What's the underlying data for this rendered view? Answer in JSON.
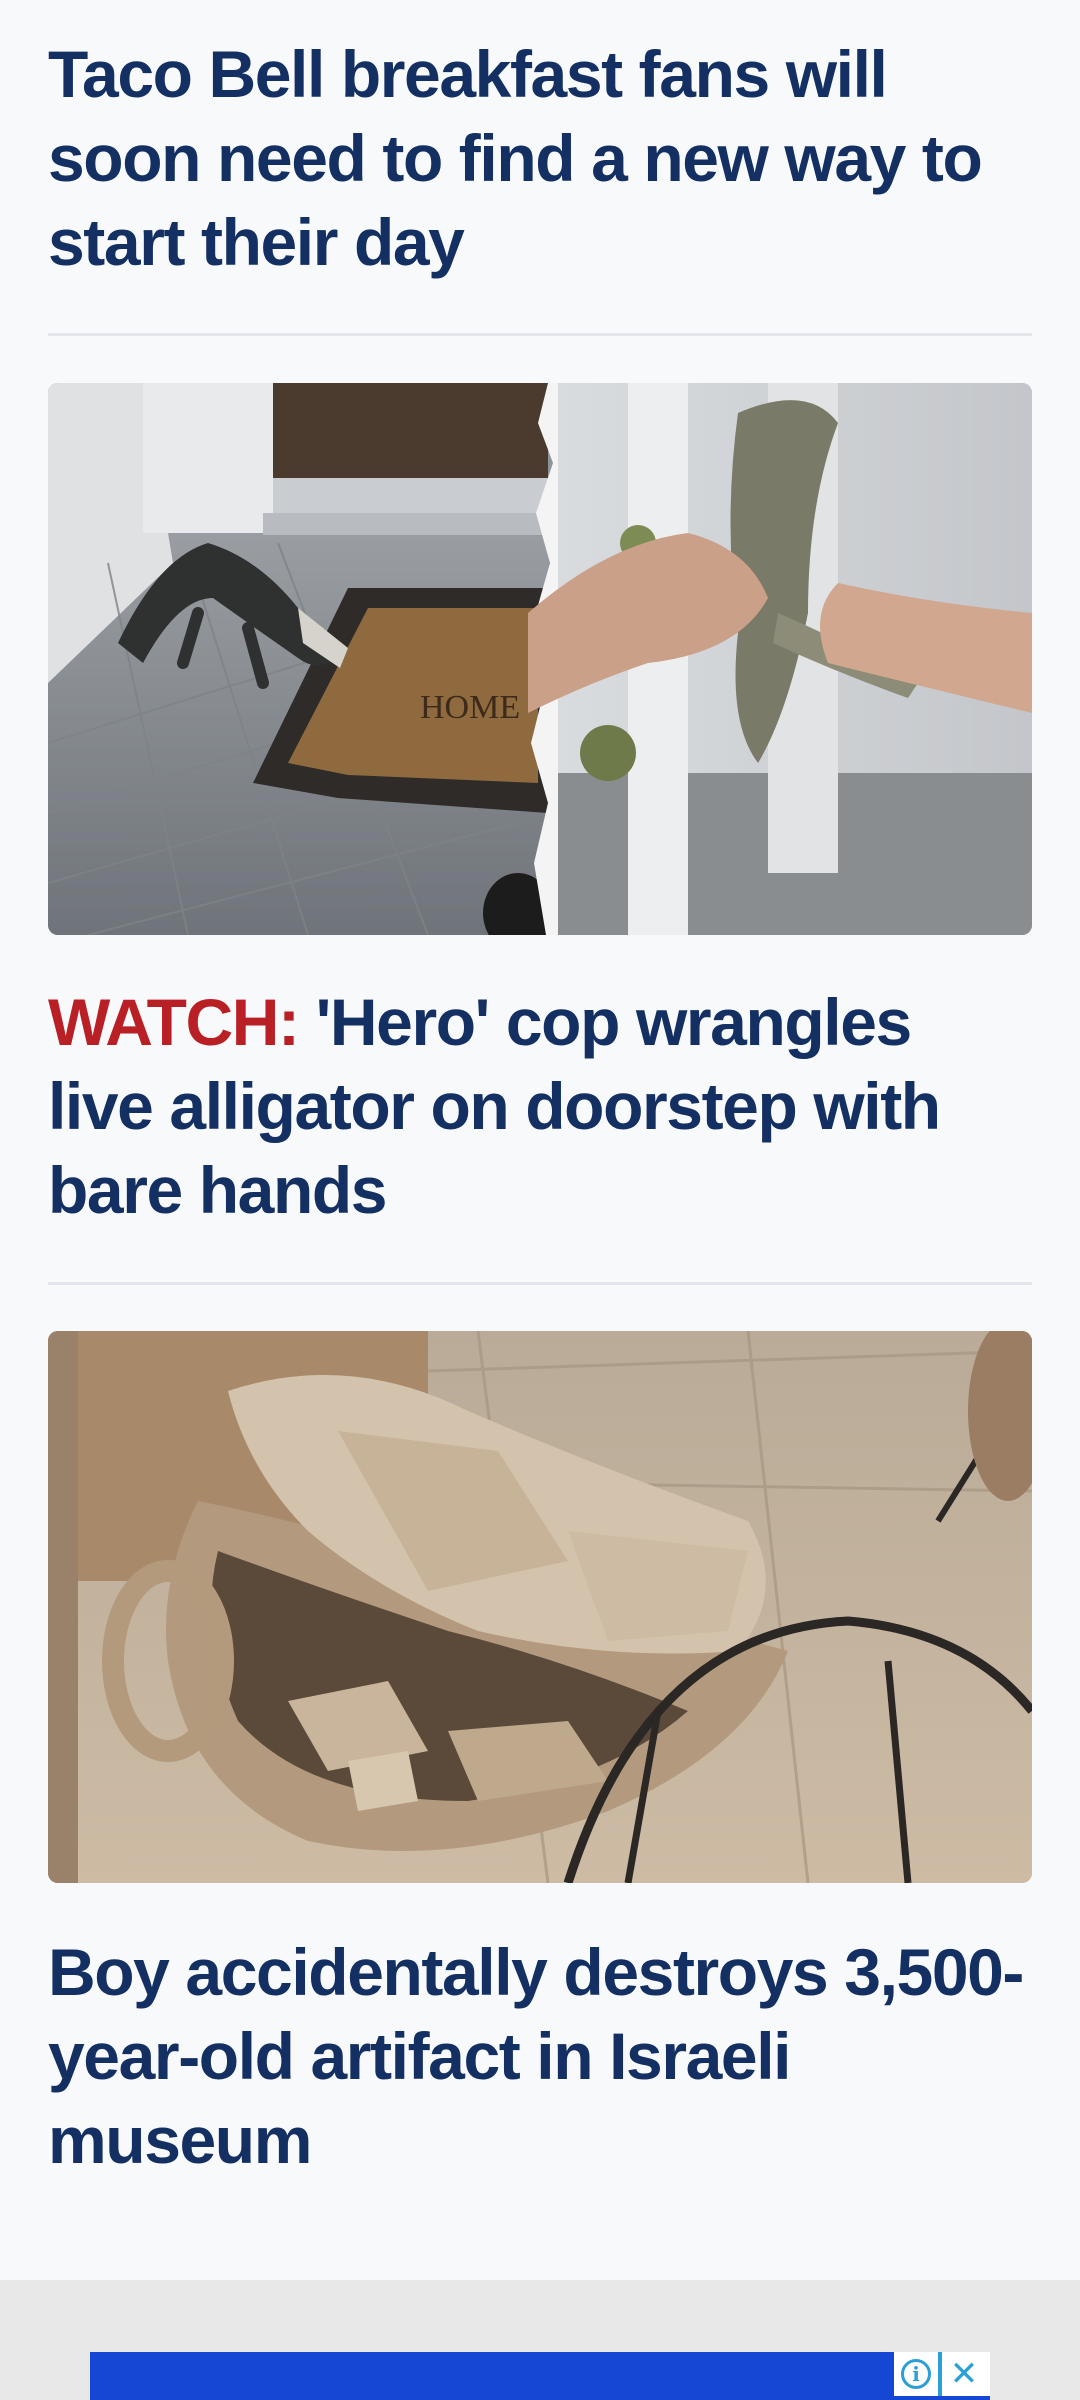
{
  "articles": [
    {
      "headline": "Taco Bell breakfast fans will soon need to find a new way to start their day"
    },
    {
      "kicker": "WATCH:",
      "headline": " 'Hero' cop wrangles live alligator on doorstep with bare hands",
      "image_alt": "Alligator on a doorstep and an officer holding it by hand",
      "doormat_text": "HOME"
    },
    {
      "headline": "Boy accidentally destroys 3,500-year-old artifact in Israeli museum",
      "image_alt": "Broken ancient clay jar lying on a museum floor"
    }
  ],
  "ad": {
    "info_icon": "info-icon",
    "info_glyph": "i",
    "close_icon": "close-icon",
    "close_glyph": "✕",
    "banner_color": "#1547d4"
  },
  "colors": {
    "headline": "#143063",
    "kicker": "#b92026",
    "background": "#f8f9fb",
    "divider": "#e3e6ea"
  }
}
